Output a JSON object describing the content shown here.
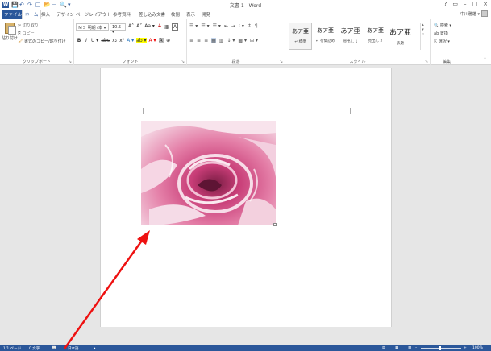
{
  "titlebar": {
    "title": "文書 1 - Word",
    "qat": [
      "W",
      "💾",
      "↶",
      "↷",
      "□",
      "📂",
      "▭",
      "🔍",
      "▾"
    ],
    "controls": [
      "?",
      "▭",
      "–",
      "□",
      "×"
    ]
  },
  "tabs": [
    "ファイル",
    "ホーム",
    "挿入",
    "デザイン",
    "ページレイアウト",
    "参考資料",
    "差し込み文書",
    "校閲",
    "表示",
    "開発"
  ],
  "user": {
    "name": "中川雅雄 ▾"
  },
  "ribbon": {
    "clipboard": {
      "paste_label": "貼り付け",
      "cut_label": "切り取り",
      "copy_label": "コピー",
      "format_label": "書式のコピー/貼り付け",
      "group_label": "クリップボード"
    },
    "font": {
      "font_name": "ＭＳ 明朝 (本 ▾",
      "font_size": "10.5 ▾",
      "grow": "A˄",
      "shrink": "A˅",
      "change_case": "Aa ▾",
      "clear_format": "A̶",
      "ruby": "亜",
      "char_border": "A",
      "bold": "B",
      "italic": "I",
      "underline": "U ▾",
      "strike": "abc",
      "subscript": "x₂",
      "superscript": "x²",
      "effects": "A ▾",
      "highlight": "ab ▾",
      "font_color": "A ▾",
      "char_shading": "A",
      "enclose": "⊕",
      "group_label": "フォント"
    },
    "paragraph": {
      "row1": [
        "☰ ▾",
        "☰ ▾",
        "☰ ▾",
        "⇤",
        "⇥",
        "⁝ ▾",
        "↕",
        "¶"
      ],
      "row2": [
        "≡",
        "≡",
        "≡",
        "▦",
        "▥",
        "↕ ▾",
        "▩ ▾",
        "⊞ ▾"
      ],
      "group_label": "段落"
    },
    "styles": {
      "items": [
        {
          "sample": "あア亜",
          "name": "↵ 標準"
        },
        {
          "sample": "あア亜",
          "name": "↵ 行間詰め"
        },
        {
          "sample": "あア亜",
          "name": "見出し 1"
        },
        {
          "sample": "あア亜",
          "name": "見出し 2"
        },
        {
          "sample": "あア亜",
          "name": "表題"
        },
        {
          "sample": "あア亜",
          "name": "副題"
        }
      ],
      "group_label": "スタイル"
    },
    "editing": {
      "find_label": "検索 ▾",
      "replace_label": "置換",
      "select_label": "選択 ▾",
      "group_label": "編集"
    }
  },
  "statusbar": {
    "page": "1/1 ページ",
    "words": "0 文字",
    "lang_icon": "📖",
    "language": "日本語",
    "macro_icon": "⏺",
    "view_read": "▤",
    "view_print": "▦",
    "view_web": "▥",
    "zoom_out": "–",
    "zoom_in": "+",
    "zoom": "100%"
  },
  "colors": {
    "accent": "#2b579a",
    "annotation": "#ee1111"
  }
}
